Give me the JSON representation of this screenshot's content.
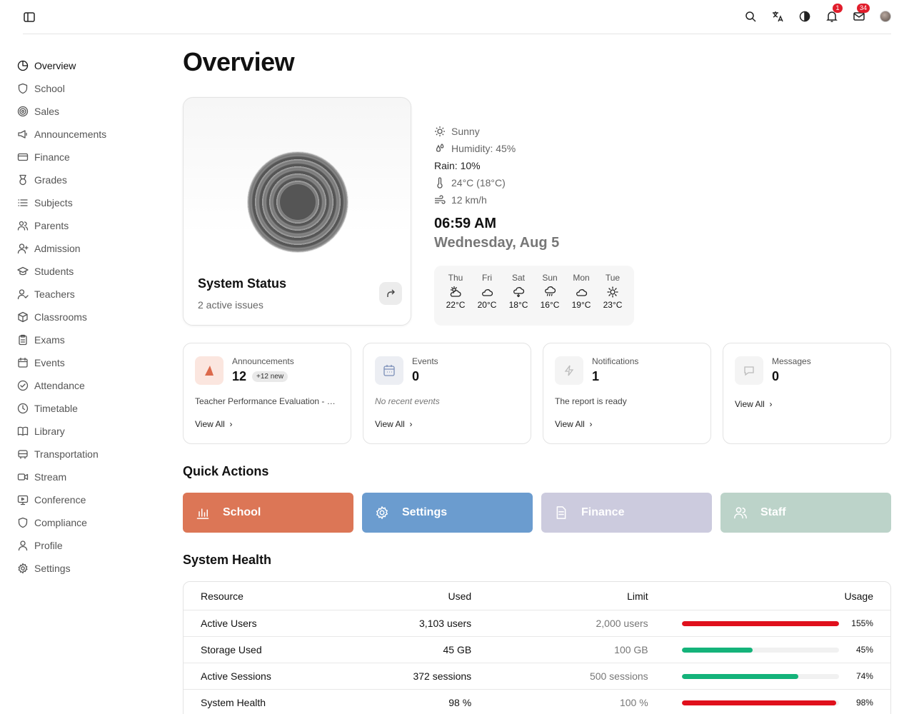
{
  "topbar": {
    "notifications_count": "1",
    "messages_count": "34"
  },
  "sidebar": {
    "items": [
      {
        "label": "Overview",
        "icon": "pie-chart-icon",
        "active": true
      },
      {
        "label": "School",
        "icon": "shield-icon"
      },
      {
        "label": "Sales",
        "icon": "target-icon"
      },
      {
        "label": "Announcements",
        "icon": "megaphone-icon"
      },
      {
        "label": "Finance",
        "icon": "credit-card-icon"
      },
      {
        "label": "Grades",
        "icon": "medal-icon"
      },
      {
        "label": "Subjects",
        "icon": "list-icon"
      },
      {
        "label": "Parents",
        "icon": "users-icon"
      },
      {
        "label": "Admission",
        "icon": "user-plus-icon"
      },
      {
        "label": "Students",
        "icon": "graduation-cap-icon"
      },
      {
        "label": "Teachers",
        "icon": "user-check-icon"
      },
      {
        "label": "Classrooms",
        "icon": "box-icon"
      },
      {
        "label": "Exams",
        "icon": "clipboard-icon"
      },
      {
        "label": "Events",
        "icon": "calendar-icon"
      },
      {
        "label": "Attendance",
        "icon": "check-circle-icon"
      },
      {
        "label": "Timetable",
        "icon": "clock-icon"
      },
      {
        "label": "Library",
        "icon": "book-icon"
      },
      {
        "label": "Transportation",
        "icon": "bus-icon"
      },
      {
        "label": "Stream",
        "icon": "video-icon"
      },
      {
        "label": "Conference",
        "icon": "monitor-icon"
      },
      {
        "label": "Compliance",
        "icon": "shield-icon"
      },
      {
        "label": "Profile",
        "icon": "user-icon"
      },
      {
        "label": "Settings",
        "icon": "gear-icon"
      }
    ]
  },
  "main": {
    "title": "Overview"
  },
  "status": {
    "title": "System Status",
    "subtitle": "2 active issues"
  },
  "weather": {
    "condition": "Sunny",
    "humidity": "Humidity: 45%",
    "rain": "Rain: 10%",
    "temperature": "24°C (18°C)",
    "wind": "12 km/h",
    "time": "06:59 AM",
    "date": "Wednesday, Aug 5",
    "forecast": [
      {
        "day": "Thu",
        "temp": "22°C",
        "icon": "cloud-sun-icon"
      },
      {
        "day": "Fri",
        "temp": "20°C",
        "icon": "cloud-icon"
      },
      {
        "day": "Sat",
        "temp": "18°C",
        "icon": "cloud-rain-icon"
      },
      {
        "day": "Sun",
        "temp": "16°C",
        "icon": "cloud-drizzle-icon"
      },
      {
        "day": "Mon",
        "temp": "19°C",
        "icon": "cloud-icon"
      },
      {
        "day": "Tue",
        "temp": "23°C",
        "icon": "sun-icon"
      }
    ]
  },
  "stats": [
    {
      "label": "Announcements",
      "value": "12",
      "badge": "+12 new",
      "desc": "Teacher Performance Evaluation - Final Review",
      "link": "View All"
    },
    {
      "label": "Events",
      "value": "0",
      "desc": "No recent events",
      "link": "View All"
    },
    {
      "label": "Notifications",
      "value": "1",
      "desc": "The report is ready",
      "link": "View All"
    },
    {
      "label": "Messages",
      "value": "0",
      "link": "View All"
    }
  ],
  "quick_actions": {
    "title": "Quick Actions",
    "items": [
      {
        "label": "School",
        "color": "#dc7656",
        "icon": "bar-chart-icon"
      },
      {
        "label": "Settings",
        "color": "#6b9ccf",
        "icon": "gear-icon"
      },
      {
        "label": "Finance",
        "color": "#cccbde",
        "icon": "file-icon"
      },
      {
        "label": "Staff",
        "color": "#bcd3c9",
        "icon": "users-icon"
      }
    ]
  },
  "health": {
    "title": "System Health",
    "headers": {
      "resource": "Resource",
      "used": "Used",
      "limit": "Limit",
      "usage": "Usage"
    },
    "rows": [
      {
        "resource": "Active Users",
        "used": "3,103 users",
        "limit": "2,000 users",
        "usage": "155%",
        "fraction": 1.0,
        "color": "#e0101c"
      },
      {
        "resource": "Storage Used",
        "used": "45 GB",
        "limit": "100 GB",
        "usage": "45%",
        "fraction": 0.45,
        "color": "#14b37a"
      },
      {
        "resource": "Active Sessions",
        "used": "372 sessions",
        "limit": "500 sessions",
        "usage": "74%",
        "fraction": 0.74,
        "color": "#14b37a"
      },
      {
        "resource": "System Health",
        "used": "98 %",
        "limit": "100 %",
        "usage": "98%",
        "fraction": 0.98,
        "color": "#e0101c"
      }
    ]
  }
}
